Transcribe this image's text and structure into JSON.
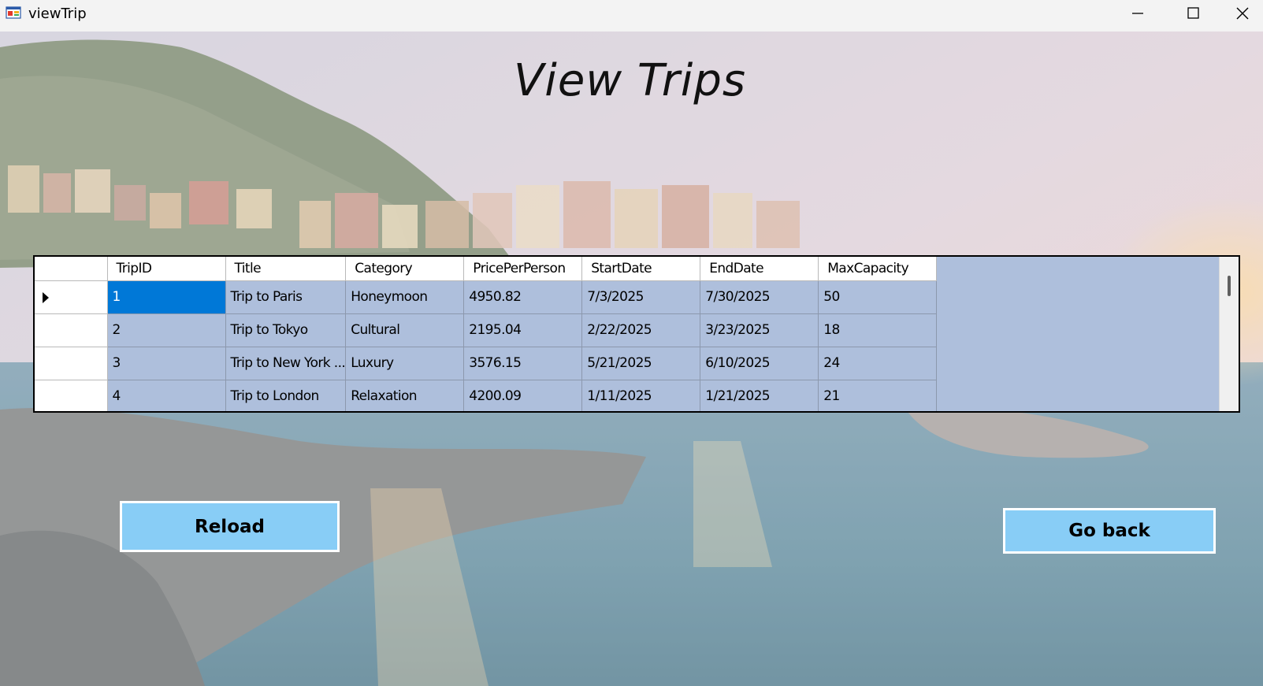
{
  "window": {
    "title": "viewTrip",
    "icon": "app-form-icon",
    "controls": [
      "minimize-icon",
      "maximize-icon",
      "close-icon"
    ]
  },
  "heading": "View Trips",
  "grid": {
    "columns": [
      "TripID",
      "Title",
      "Category",
      "PricePerPerson",
      "StartDate",
      "EndDate",
      "MaxCapacity"
    ],
    "rows": [
      [
        "1",
        "Trip to Paris",
        "Honeymoon",
        "4950.82",
        "7/3/2025",
        "7/30/2025",
        "50"
      ],
      [
        "2",
        "Trip to Tokyo",
        "Cultural",
        "2195.04",
        "2/22/2025",
        "3/23/2025",
        "18"
      ],
      [
        "3",
        "Trip to New York ...",
        "Luxury",
        "3576.15",
        "5/21/2025",
        "6/10/2025",
        "24"
      ],
      [
        "4",
        "Trip to London",
        "Relaxation",
        "4200.09",
        "1/11/2025",
        "1/21/2025",
        "21"
      ]
    ],
    "selected_row": 0,
    "selected_cell": "TripID"
  },
  "buttons": {
    "reload": "Reload",
    "go_back": "Go back"
  },
  "colors": {
    "grid_background": "#aebfdc",
    "selection": "#0078d7",
    "button": "#88cdf6"
  }
}
